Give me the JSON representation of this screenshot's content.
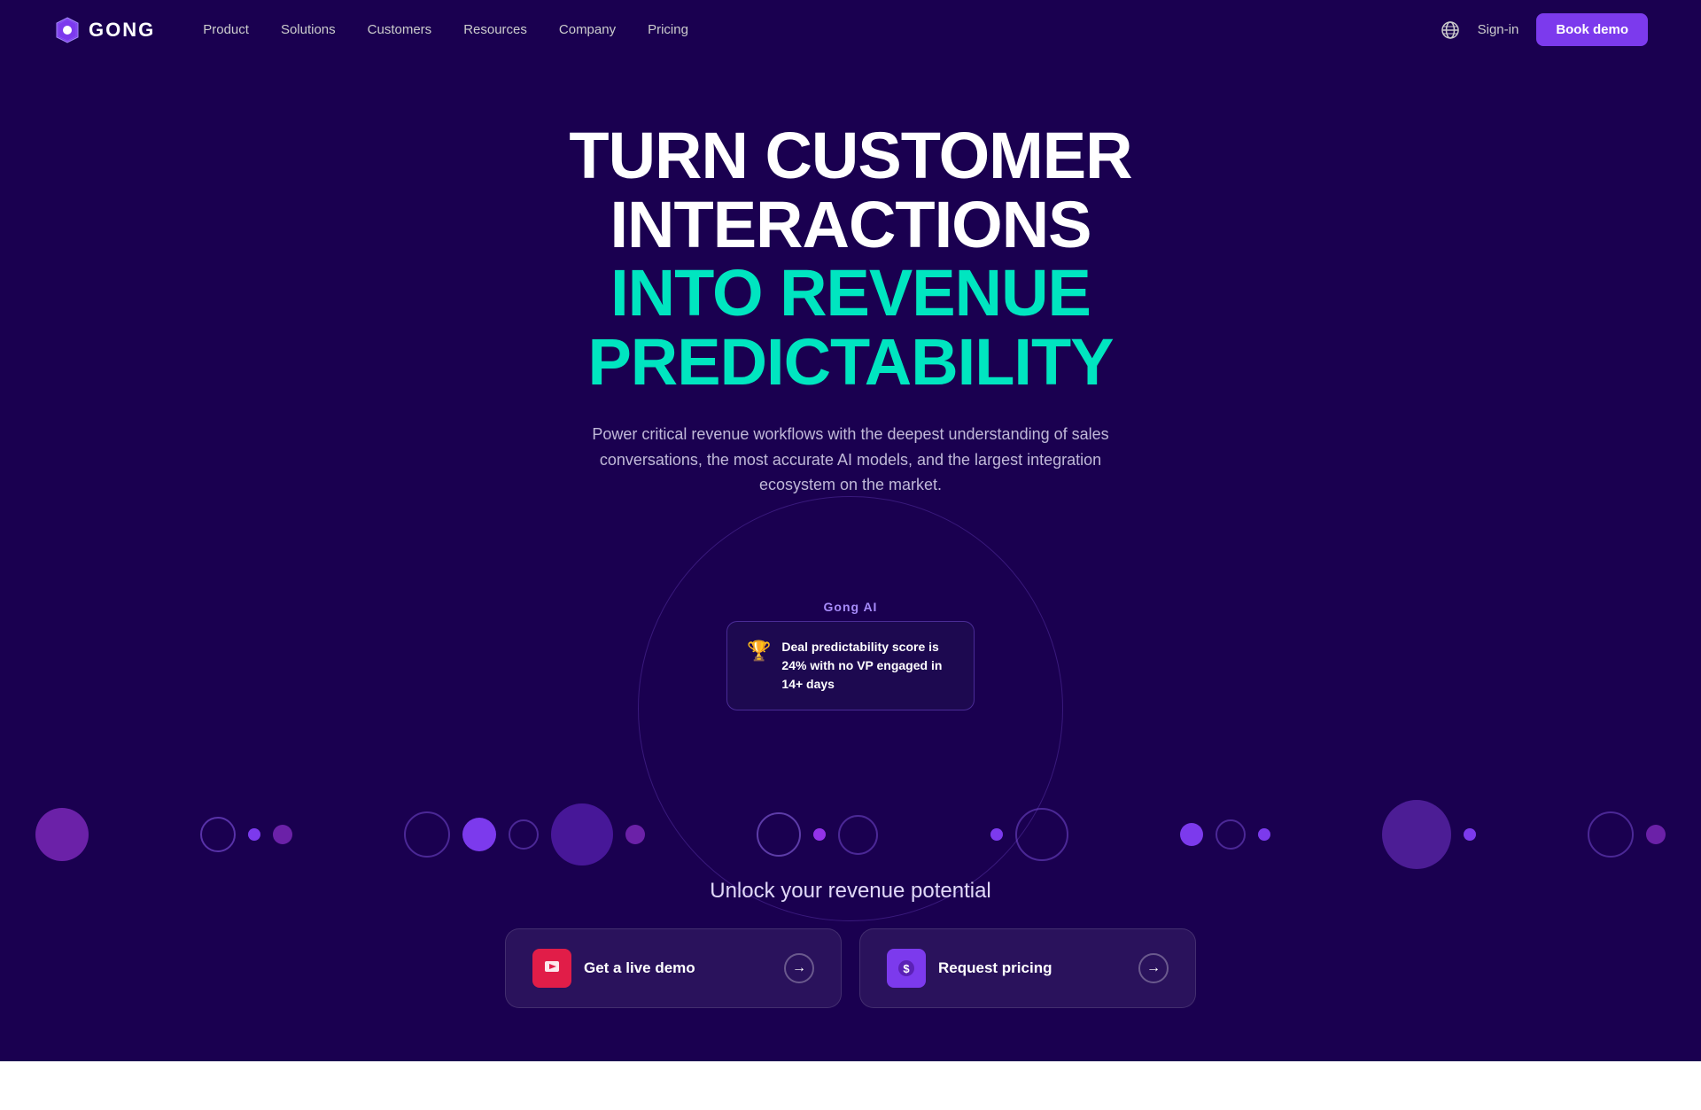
{
  "nav": {
    "logo_text": "GONG",
    "links": [
      {
        "label": "Product",
        "id": "product"
      },
      {
        "label": "Solutions",
        "id": "solutions"
      },
      {
        "label": "Customers",
        "id": "customers"
      },
      {
        "label": "Resources",
        "id": "resources"
      },
      {
        "label": "Company",
        "id": "company"
      },
      {
        "label": "Pricing",
        "id": "pricing"
      }
    ],
    "signin_label": "Sign-in",
    "book_demo_label": "Book demo"
  },
  "hero": {
    "title_line1": "TURN CUSTOMER INTERACTIONS",
    "title_line2": "INTO REVENUE PREDICTABILITY",
    "subtitle": "Power critical revenue workflows with the deepest understanding of sales conversations, the most accurate AI models, and the largest integration ecosystem on the market.",
    "gong_ai_label": "Gong AI",
    "popup_text": "Deal predictability score is 24% with no VP engaged in 14+ days"
  },
  "cta": {
    "title": "Unlock your revenue potential",
    "demo_label": "Get a live demo",
    "pricing_label": "Request pricing"
  },
  "colors": {
    "bg": "#1a0050",
    "accent": "#7c3aed",
    "cyan": "#00e5c0"
  }
}
